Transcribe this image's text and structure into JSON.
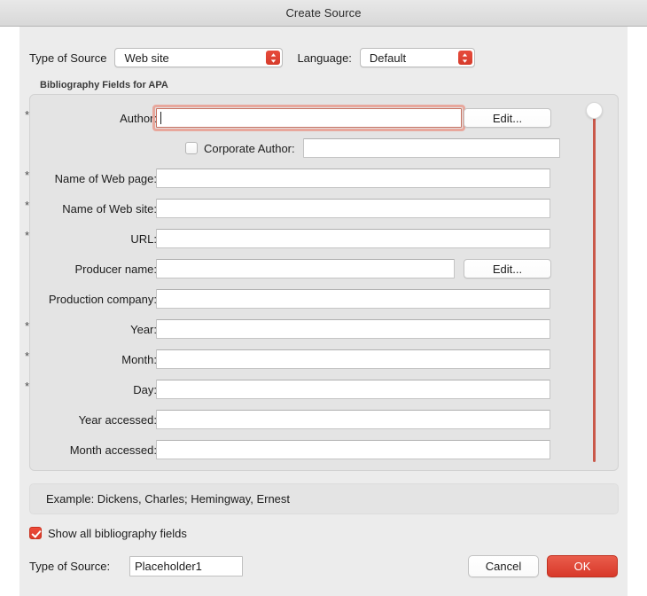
{
  "window": {
    "title": "Create Source"
  },
  "top_controls": {
    "source_label": "Type of Source",
    "source_value": "Web site",
    "language_label": "Language:",
    "language_value": "Default"
  },
  "group": {
    "title": "Bibliography Fields for APA",
    "rows": [
      {
        "label": "Author:",
        "required": "*",
        "value": "",
        "focused": true,
        "edit_button": "Edit...",
        "width": "short"
      },
      {
        "label": "",
        "required": "",
        "value": "",
        "focused": false,
        "edit_button": "",
        "width": "corporate",
        "checkbox_label": "Corporate Author:",
        "checked": false
      },
      {
        "label": "Name of Web page:",
        "required": "*",
        "value": "",
        "focused": false,
        "edit_button": "",
        "width": "full"
      },
      {
        "label": "Name of Web site:",
        "required": "*",
        "value": "",
        "focused": false,
        "edit_button": "",
        "width": "full"
      },
      {
        "label": "URL:",
        "required": "*",
        "value": "",
        "focused": false,
        "edit_button": "",
        "width": "full"
      },
      {
        "label": "Producer name:",
        "required": "",
        "value": "",
        "focused": false,
        "edit_button": "Edit...",
        "width": "short"
      },
      {
        "label": "Production company:",
        "required": "",
        "value": "",
        "focused": false,
        "edit_button": "",
        "width": "full"
      },
      {
        "label": "Year:",
        "required": "*",
        "value": "",
        "focused": false,
        "edit_button": "",
        "width": "full"
      },
      {
        "label": "Month:",
        "required": "*",
        "value": "",
        "focused": false,
        "edit_button": "",
        "width": "full"
      },
      {
        "label": "Day:",
        "required": "*",
        "value": "",
        "focused": false,
        "edit_button": "",
        "width": "full"
      },
      {
        "label": "Year accessed:",
        "required": "",
        "value": "",
        "focused": false,
        "edit_button": "",
        "width": "full"
      },
      {
        "label": "Month accessed:",
        "required": "",
        "value": "",
        "focused": false,
        "edit_button": "",
        "width": "full"
      }
    ]
  },
  "example": {
    "text": "Example: Dickens, Charles; Hemingway, Ernest"
  },
  "show_all": {
    "label": "Show all bibliography fields",
    "checked": true
  },
  "footer": {
    "tag_label": "Type of Source:",
    "tag_value": "Placeholder1",
    "cancel_label": "Cancel",
    "ok_label": "OK"
  },
  "colors": {
    "accent_red": "#d8392a",
    "focus_ring": "#e8a79c",
    "window_bg": "#ececec",
    "group_bg": "#e4e4e4"
  }
}
